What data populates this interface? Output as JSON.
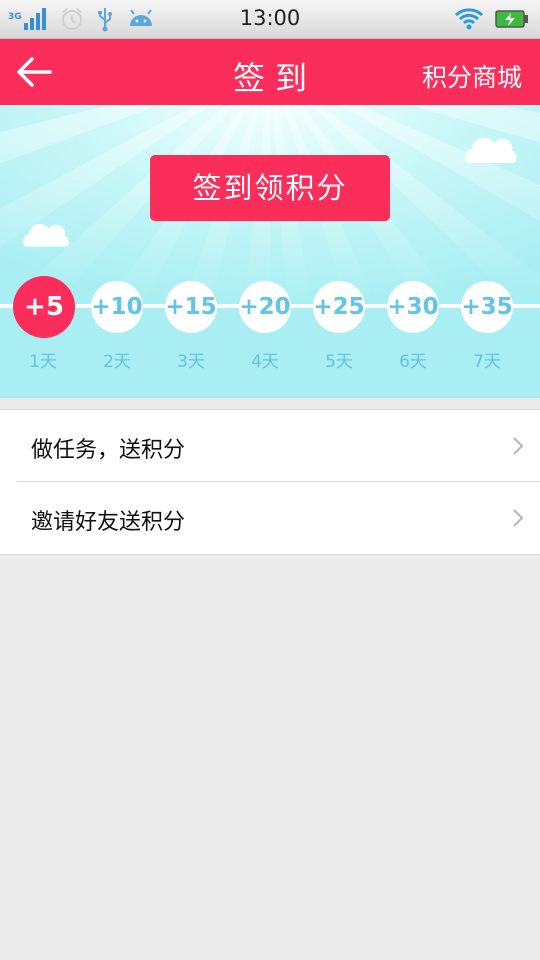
{
  "status_bar": {
    "network": "3G",
    "time": "13:00"
  },
  "header": {
    "title": "签到",
    "shop_link": "积分商城"
  },
  "hero": {
    "checkin_button": "签到领积分",
    "days": [
      {
        "points": "+5",
        "label": "1天",
        "active": true
      },
      {
        "points": "+10",
        "label": "2天",
        "active": false
      },
      {
        "points": "+15",
        "label": "3天",
        "active": false
      },
      {
        "points": "+20",
        "label": "4天",
        "active": false
      },
      {
        "points": "+25",
        "label": "5天",
        "active": false
      },
      {
        "points": "+30",
        "label": "6天",
        "active": false
      },
      {
        "points": "+35",
        "label": "7天",
        "active": false
      }
    ]
  },
  "list": {
    "items": [
      {
        "label": "做任务，送积分"
      },
      {
        "label": "邀请好友送积分"
      }
    ]
  },
  "colors": {
    "accent": "#fb2d5b",
    "day_text": "#64c3e8",
    "hero_bg": "#c9f7f7"
  },
  "icons": {
    "back": "arrow-left-icon",
    "chevron": "chevron-right-icon",
    "wifi": "wifi-icon",
    "battery": "battery-charging-icon"
  }
}
